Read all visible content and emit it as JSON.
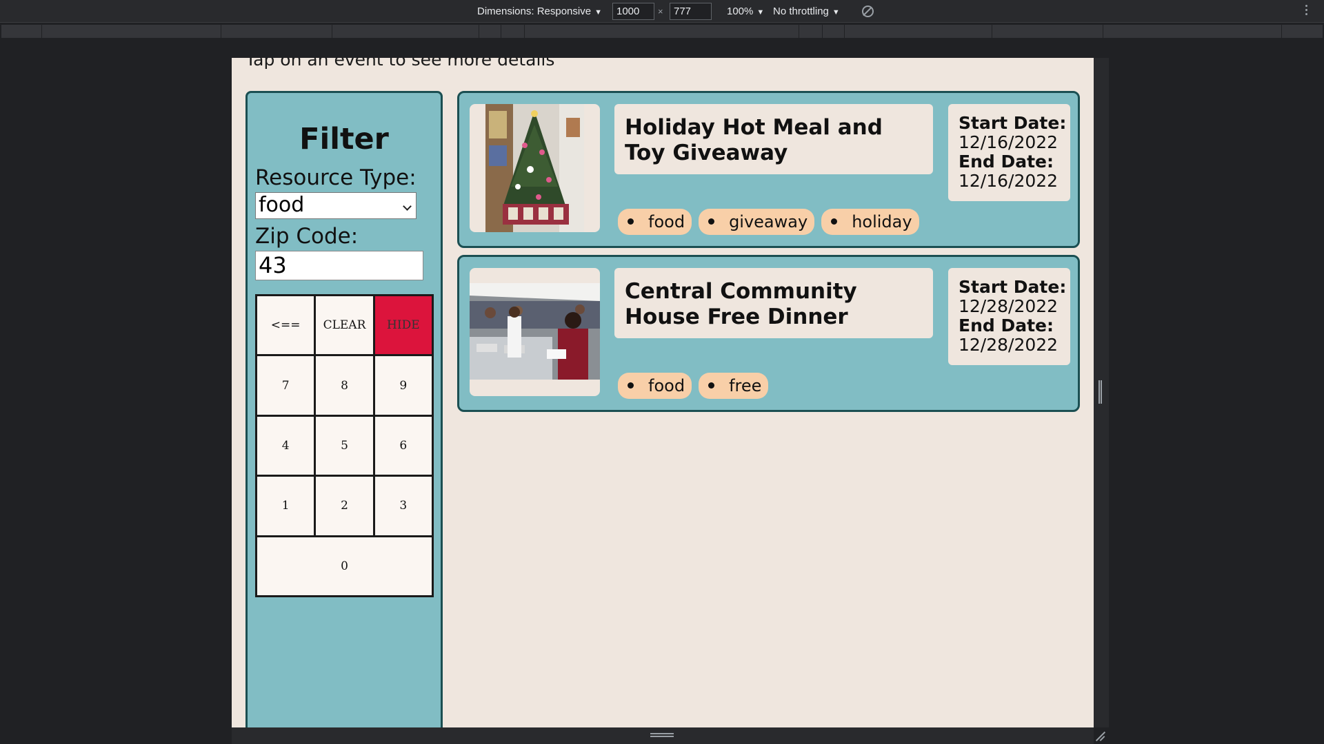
{
  "devtools": {
    "dimensions_label": "Dimensions: Responsive",
    "width_value": "1000",
    "times_sign": "×",
    "height_value": "777",
    "zoom_label": "100%",
    "throttling_label": "No throttling",
    "caret": "▼"
  },
  "page": {
    "intro_text": "Tap on an event to see more details"
  },
  "filter": {
    "title": "Filter",
    "resource_type_label": "Resource Type:",
    "resource_type_value": "food",
    "zip_label": "Zip Code:",
    "zip_value": "43",
    "keypad": {
      "backspace": "<==",
      "clear": "CLEAR",
      "hide": "HIDE",
      "k7": "7",
      "k8": "8",
      "k9": "9",
      "k4": "4",
      "k5": "5",
      "k6": "6",
      "k1": "1",
      "k2": "2",
      "k3": "3",
      "k0": "0"
    }
  },
  "events": [
    {
      "title": "Holiday Hot Meal and Toy Giveaway",
      "start_label": "Start Date:",
      "start_date": "12/16/2022",
      "end_label": "End Date:",
      "end_date": "12/16/2022",
      "tags": [
        "food",
        "giveaway",
        "holiday"
      ]
    },
    {
      "title": "Central Community House Free Dinner",
      "start_label": "Start Date:",
      "start_date": "12/28/2022",
      "end_label": "End Date:",
      "end_date": "12/28/2022",
      "tags": [
        "food",
        "free"
      ]
    }
  ],
  "colors": {
    "page_bg": "#efe6de",
    "panel_teal": "#81bdc4",
    "panel_border": "#1b4f52",
    "tag_bg": "#f8cfa8",
    "hide_red": "#dc143c",
    "devtools_bg": "#292a2d"
  }
}
